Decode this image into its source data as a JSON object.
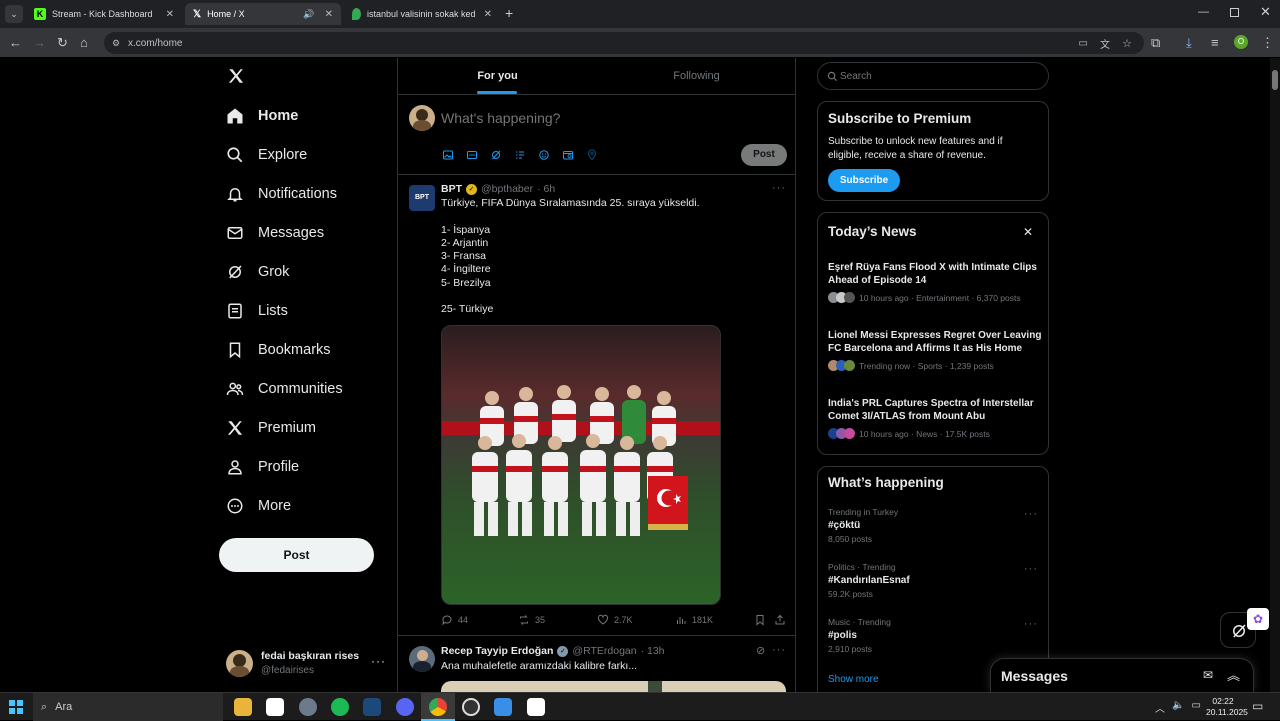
{
  "browser": {
    "tabs": [
      {
        "title": "Stream - Kick Dashboard"
      },
      {
        "title": "Home / X"
      },
      {
        "title": "istanbul valisinin sokak kediler"
      }
    ],
    "url": "x.com/home"
  },
  "sidebar": {
    "items": [
      {
        "label": "Home",
        "icon": "home-icon"
      },
      {
        "label": "Explore",
        "icon": "search-icon"
      },
      {
        "label": "Notifications",
        "icon": "bell-icon"
      },
      {
        "label": "Messages",
        "icon": "mail-icon"
      },
      {
        "label": "Grok",
        "icon": "grok-icon"
      },
      {
        "label": "Lists",
        "icon": "list-icon"
      },
      {
        "label": "Bookmarks",
        "icon": "bookmark-icon"
      },
      {
        "label": "Communities",
        "icon": "people-icon"
      },
      {
        "label": "Premium",
        "icon": "x-logo-icon"
      },
      {
        "label": "Profile",
        "icon": "person-icon"
      },
      {
        "label": "More",
        "icon": "more-circle-icon"
      }
    ],
    "post_label": "Post",
    "account": {
      "name": "fedai başkıran rises",
      "handle": "@fedairises"
    }
  },
  "timeline": {
    "tabs": [
      "For you",
      "Following"
    ],
    "composer": {
      "placeholder": "What's happening?",
      "post_label": "Post"
    },
    "tweets": [
      {
        "name": "BPT",
        "handle": "@bpthaber",
        "time": "· 6h",
        "avatar_text": "BPT",
        "text_lines": [
          "Türkiye, FIFA Dünya Sıralamasında 25. sıraya yükseldi.",
          "",
          "1- İspanya",
          "2- Arjantin",
          "3- Fransa",
          "4- İngiltere",
          "5- Brezilya",
          "",
          "25- Türkiye"
        ],
        "stats": {
          "replies": "44",
          "reposts": "35",
          "likes": "2.7K",
          "views": "181K"
        }
      },
      {
        "name": "Recep Tayyip Erdoğan",
        "handle": "@RTErdogan",
        "time": "· 13h",
        "text": "Ana muhalefetle aramızdaki kalibre farkı..."
      }
    ]
  },
  "right": {
    "search_placeholder": "Search",
    "premium": {
      "title": "Subscribe to Premium",
      "body": "Subscribe to unlock new features and if eligible, receive a share of revenue.",
      "button": "Subscribe"
    },
    "news": {
      "title": "Today’s News",
      "items": [
        {
          "title": "Eşref Rüya Fans Flood X with Intimate Clips Ahead of Episode 14",
          "meta": "10 hours ago · Entertainment · 6,370 posts"
        },
        {
          "title": "Lionel Messi Expresses Regret Over Leaving FC Barcelona and Affirms It as His Home",
          "meta": "Trending now · Sports · 1,239 posts"
        },
        {
          "title": "India's PRL Captures Spectra of Interstellar Comet 3I/ATLAS from Mount Abu",
          "meta": "10 hours ago · News · 17.5K posts"
        }
      ]
    },
    "happening": {
      "title": "What’s happening",
      "items": [
        {
          "context": "Trending in Turkey",
          "tag": "#çöktü",
          "posts": "8,050 posts"
        },
        {
          "context": "Politics · Trending",
          "tag": "#KandırılanEsnaf",
          "posts": "59.2K posts"
        },
        {
          "context": "Music · Trending",
          "tag": "#polis",
          "posts": "2,910 posts"
        }
      ],
      "show_more": "Show more"
    },
    "messages_drawer": "Messages"
  },
  "taskbar": {
    "search": "Ara",
    "time": "02:22",
    "date": "20.11.2025"
  },
  "colors": {
    "accent": "#1d9bf0",
    "background": "#000000",
    "border": "#2f3336"
  }
}
